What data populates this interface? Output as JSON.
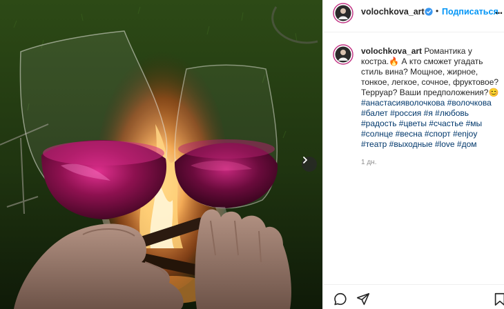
{
  "post": {
    "username": "volochkova_art",
    "follow_label": "Подписаться",
    "separator": "•",
    "more_label": "...",
    "comment": {
      "username": "volochkova_art",
      "text": "Романтика у костра.🔥 А кто сможет угадать стиль вина? Мощное, жирное, тонкое, легкое, сочное, фруктовое? Терруар? Ваши предположения?😊",
      "hashtags": [
        "#анастасияволочкова",
        "#волочкова",
        "#балет",
        "#россия",
        "#я",
        "#любовь",
        "#радость",
        "#цветы",
        "#счастье",
        "#мы",
        "#солнце",
        "#весна",
        "#спорт",
        "#enjoy",
        "#театр",
        "#выходные",
        "#love",
        "#дом"
      ]
    },
    "time_ago": "1 дн."
  },
  "colors": {
    "accent": "#0095f6",
    "hashtag": "#00376b",
    "text": "#262626",
    "muted": "#8e8e8e"
  },
  "icons": {
    "next": "chevron-right-icon",
    "verified": "verified-badge-icon",
    "comment": "comment-icon",
    "share": "share-icon",
    "save": "bookmark-icon"
  }
}
